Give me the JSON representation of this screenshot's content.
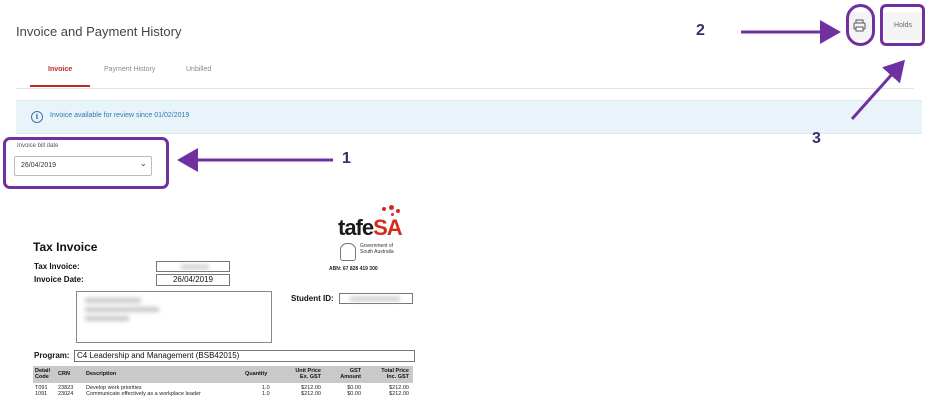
{
  "page": {
    "title": "Invoice and Payment History"
  },
  "tabs": [
    {
      "label": "Invoice",
      "active": true
    },
    {
      "label": "Payment History",
      "active": false
    },
    {
      "label": "Unbilled",
      "active": false
    }
  ],
  "notice": {
    "icon": "info-icon",
    "text": "Invoice available for review since 01/02/2019"
  },
  "actions": {
    "print_icon": "printer-icon",
    "holds_label": "Holds"
  },
  "bill_date": {
    "label": "Invoice bill date",
    "value": "26/04/2019"
  },
  "callouts": {
    "one": "1",
    "two": "2",
    "three": "3"
  },
  "colors": {
    "accent": "#c0272d",
    "annotation": "#7030a0",
    "notice_text": "#3576b3"
  },
  "invoice": {
    "logo_main": "tafe",
    "logo_suffix": "SA",
    "gov_line1": "Government of",
    "gov_line2": "South Australia",
    "abn": "ABN: 67 828 419 300",
    "title": "Tax Invoice",
    "tax_invoice_label": "Tax Invoice:",
    "invoice_date_label": "Invoice Date:",
    "invoice_date": "26/04/2019",
    "student_id_label": "Student ID:",
    "program_label": "Program:",
    "program_value": "C4 Leadership and Management (BSB42015)",
    "columns": {
      "detail_code_1": "Detail",
      "detail_code_2": "Code",
      "crn": "CRN",
      "description": "Description",
      "quantity": "Quantity",
      "unit_price_1": "Unit Price",
      "unit_price_2": "Ex. GST",
      "gst_1": "GST",
      "gst_2": "Amount",
      "total_1": "Total Price",
      "total_2": "Inc. GST"
    },
    "rows": [
      {
        "code": "T091",
        "crn": "23823",
        "description": "Develop work priorities",
        "qty": "1.0",
        "unit": "$212.00",
        "gst": "$0.00",
        "total": "$212.00"
      },
      {
        "code": "1091",
        "crn": "23024",
        "description": "Communicate effectively as a workplace leader",
        "qty": "1.0",
        "unit": "$212.00",
        "gst": "$0.00",
        "total": "$212.00"
      }
    ]
  }
}
